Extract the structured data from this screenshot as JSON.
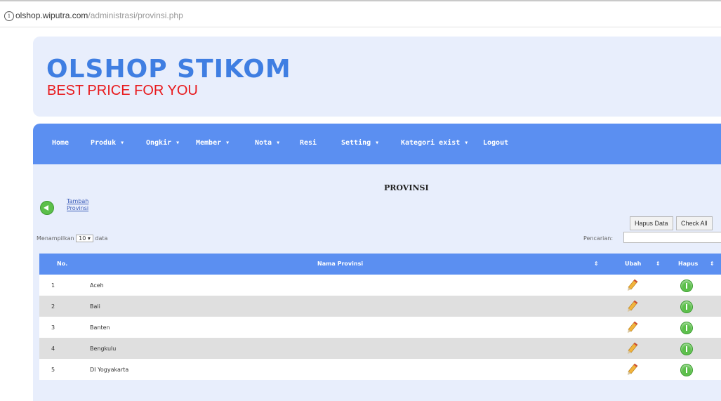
{
  "browser": {
    "url_host": "olshop.wiputra.com",
    "url_path": "/administrasi/provinsi.php"
  },
  "header": {
    "logo": "OLSHOP STIKOM",
    "tagline": "BEST PRICE FOR YOU"
  },
  "nav": {
    "items": [
      "Home",
      "Produk ▾",
      "Ongkir ▾",
      "Member ▾",
      "Nota ▾",
      "Resi",
      "Setting ▾",
      "Kategori exist ▾",
      "Logout"
    ]
  },
  "main": {
    "title": "PROVINSI",
    "add_link": "Tambah Provinsi",
    "hapus_data": "Hapus Data",
    "check_all": "Check All",
    "show_prefix": "Menampilkan",
    "show_value": "10",
    "show_suffix": "data",
    "search_label": "Pencarian:"
  },
  "table": {
    "headers": [
      "No.",
      "Nama Provinsi",
      "Ubah",
      "Hapus"
    ],
    "rows": [
      {
        "no": "1",
        "name": "Aceh"
      },
      {
        "no": "2",
        "name": "Bali"
      },
      {
        "no": "3",
        "name": "Banten"
      },
      {
        "no": "4",
        "name": "Bengkulu"
      },
      {
        "no": "5",
        "name": "DI Yogyakarta"
      }
    ]
  }
}
